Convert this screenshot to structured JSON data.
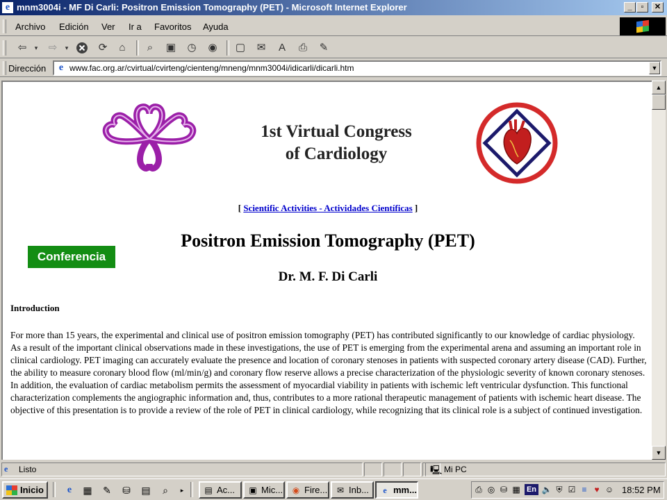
{
  "window": {
    "title": "mnm3004i - MF Di Carli: Positron Emission Tomography (PET) - Microsoft Internet Explorer",
    "app_icon": "e",
    "buttons": [
      "_",
      "▫",
      "✕"
    ]
  },
  "menu": [
    "Archivo",
    "Edición",
    "Ver",
    "Ir a",
    "Favoritos",
    "Ayuda"
  ],
  "toolbar": {
    "icons": [
      "back-icon",
      "forward-icon",
      "stop-icon",
      "refresh-icon",
      "home-icon",
      "search-icon",
      "favorites-icon",
      "history-icon",
      "channels-icon",
      "fullscreen-icon",
      "mail-icon",
      "font-icon",
      "print-icon",
      "edit-icon"
    ]
  },
  "address": {
    "label": "Dirección",
    "url": "www.fac.org.ar/cvirtual/cvirteng/cienteng/mneng/mnm3004i/idicarli/dicarli.htm"
  },
  "page": {
    "congress_line1": "1st Virtual Congress",
    "congress_line2": "of Cardiology",
    "nav_open": "[ ",
    "nav_link": "Scientific Activities - Actividades Científicas",
    "nav_close": " ]",
    "title": "Positron Emission Tomography (PET)",
    "badge": "Conferencia",
    "author": "Dr. M. F. Di Carli",
    "heading": "Introduction",
    "body": "For more than 15 years, the experimental and clinical use of positron emission tomography (PET) has contributed significantly to our knowledge of cardiac physiology. As a result of the important clinical observations made in these investigations, the use of PET is emerging from the experimental arena and assuming an important role in clinical cardiology. PET imaging can accurately evaluate the presence and location of coronary stenoses in patients with suspected coronary artery disease (CAD). Further, the ability to measure coronary blood flow (ml/min/g) and coronary flow reserve allows a precise characterization of the physiologic severity of known coronary stenoses. In addition, the evaluation of cardiac metabolism permits the assessment of myocardial viability in patients with ischemic left ventricular dysfunction. This functional characterization complements the angiographic information and, thus, contributes to a more rational therapeutic management of patients with ischemic heart disease. The objective of this presentation is to provide a review of the role of PET in clinical cardiology, while recognizing that its clinical role is a subject of continued investigation."
  },
  "status": {
    "text": "Listo",
    "zone": "Mi PC"
  },
  "taskbar": {
    "start": "Inicio",
    "tasks": [
      {
        "label": "Ac...",
        "icon": "folder-icon"
      },
      {
        "label": "Mic...",
        "icon": "window-icon"
      },
      {
        "label": "Fire...",
        "icon": "firefox-icon"
      },
      {
        "label": "Inb...",
        "icon": "mail-icon"
      },
      {
        "label": "mm...",
        "icon": "ie-icon"
      }
    ],
    "language": "En",
    "clock": "18:52 PM"
  },
  "colors": {
    "logo_purple": "#9b1fa8",
    "logo_red": "#d42a2a",
    "badge_green": "#138d13",
    "link_blue": "#0000cc"
  }
}
